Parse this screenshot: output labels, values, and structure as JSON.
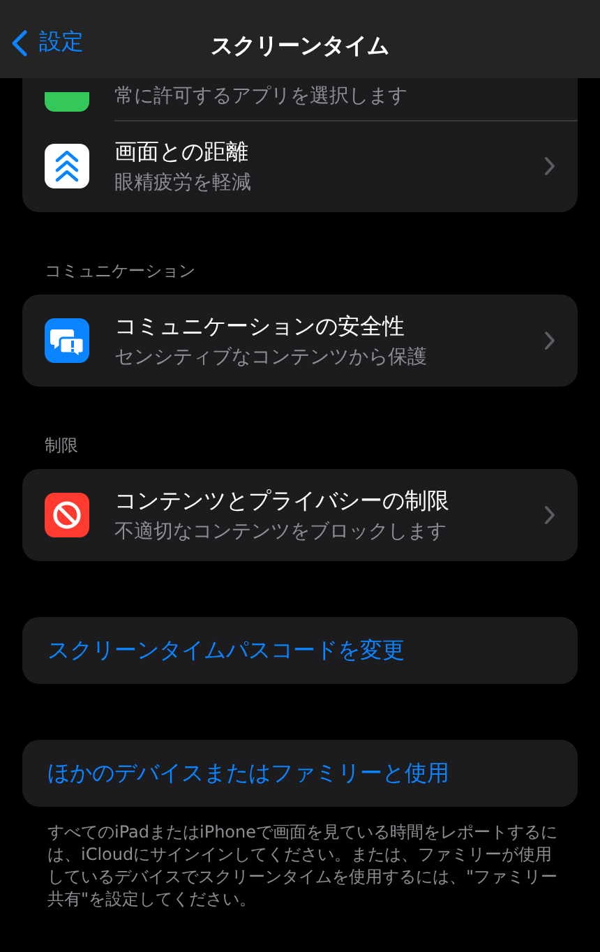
{
  "nav": {
    "back": "設定",
    "title": "スクリーンタイム"
  },
  "groups": [
    {
      "rows": [
        {
          "kind": "nav",
          "subtitle": "常に許可するアプリを選択します"
        },
        {
          "kind": "nav",
          "title": "画面との距離",
          "subtitle": "眼精疲労を軽減"
        }
      ]
    },
    {
      "header": "コミュニケーション",
      "rows": [
        {
          "kind": "nav",
          "title": "コミュニケーションの安全性",
          "subtitle": "センシティブなコンテンツから保護"
        }
      ]
    },
    {
      "header": "制限",
      "rows": [
        {
          "kind": "nav",
          "title": "コンテンツとプライバシーの制限",
          "subtitle": "不適切なコンテンツをブロックします"
        }
      ]
    },
    {
      "rows": [
        {
          "kind": "link",
          "title": "スクリーンタイムパスコードを変更"
        }
      ]
    },
    {
      "rows": [
        {
          "kind": "link",
          "title": "ほかのデバイスまたはファミリーと使用"
        }
      ]
    }
  ],
  "footer": "すべてのiPadまたはiPhoneで画面を見ている時間をレポートするには、iCloudにサインインしてください。または、ファミリーが使用しているデバイスでスクリーンタイムを使用するには、\"ファミリー共有\"を設定してください。"
}
